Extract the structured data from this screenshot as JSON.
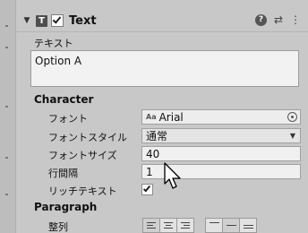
{
  "header": {
    "component_icon_letter": "T",
    "title": "Text",
    "enabled": true,
    "icons": [
      "help-icon",
      "preset-icon",
      "more-icon"
    ]
  },
  "text_label": "テキスト",
  "text_value": "Option A",
  "character": {
    "heading": "Character",
    "font_label": "フォント",
    "font_value": "Arial",
    "font_icon_text": "Aa",
    "style_label": "フォントスタイル",
    "style_value": "通常",
    "size_label": "フォントサイズ",
    "size_value": "40",
    "spacing_label": "行間隔",
    "spacing_value": "1",
    "rich_label": "リッチテキスト",
    "rich_checked": true
  },
  "paragraph": {
    "heading": "Paragraph",
    "align_label": "整列",
    "horizontal_align": [
      "left",
      "center",
      "right"
    ],
    "vertical_align": [
      "top",
      "middle",
      "bottom"
    ],
    "selected_horizontal": "left",
    "selected_vertical": "middle"
  }
}
